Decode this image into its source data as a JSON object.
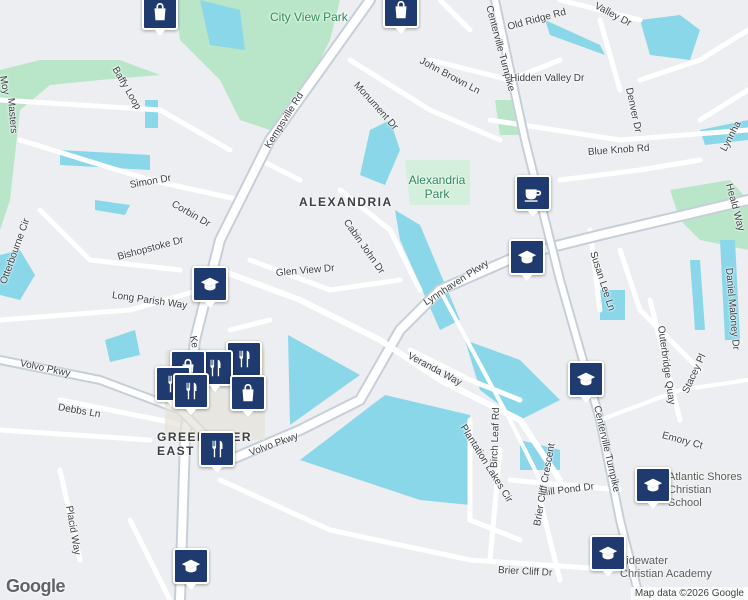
{
  "map": {
    "area_labels": [
      {
        "id": "alexandria",
        "text": "ALEXANDRIA"
      },
      {
        "id": "greenbrier-east",
        "text": "GREENBRIER EAST"
      }
    ],
    "park_labels": [
      {
        "id": "city-view-park",
        "text": "City View Park"
      },
      {
        "id": "alexandria-park",
        "text": "Alexandria Park"
      }
    ],
    "street_labels": [
      {
        "id": "kempsville-rd",
        "text": "Kempsville Rd"
      },
      {
        "id": "kempsville-rd-lower",
        "text": "Ke"
      },
      {
        "id": "monument-dr",
        "text": "Monument Dr"
      },
      {
        "id": "john-brown-ln",
        "text": "John Brown Ln"
      },
      {
        "id": "centerville-tpk-top",
        "text": "Centerville Turnpike"
      },
      {
        "id": "old-ridge-rd",
        "text": "Old Ridge Rd"
      },
      {
        "id": "hidden-valley-dr",
        "text": "Hidden Valley Dr"
      },
      {
        "id": "valley-dr",
        "text": "Valley Dr"
      },
      {
        "id": "denver-dr",
        "text": "Denver Dr"
      },
      {
        "id": "blue-knob-rd",
        "text": "Blue Knob Rd"
      },
      {
        "id": "lynnhaven-top-right",
        "text": "Lynnha"
      },
      {
        "id": "heald-way",
        "text": "Heald Way"
      },
      {
        "id": "baffy-loop",
        "text": "Baffy Loop"
      },
      {
        "id": "masters",
        "text": "Masters"
      },
      {
        "id": "moy",
        "text": "Moy"
      },
      {
        "id": "simon-dr",
        "text": "Simon Dr"
      },
      {
        "id": "corbin-dr",
        "text": "Corbin Dr"
      },
      {
        "id": "cabin-john-dr",
        "text": "Cabin John Dr"
      },
      {
        "id": "glen-view-dr",
        "text": "Glen View Dr"
      },
      {
        "id": "bishopstoke-dr",
        "text": "Bishopstoke Dr"
      },
      {
        "id": "otterbourne-cir",
        "text": "Otterbourne Cir"
      },
      {
        "id": "long-parish-way",
        "text": "Long Parish Way"
      },
      {
        "id": "lynnhaven-pkwy",
        "text": "Lynnhaven Pkwy"
      },
      {
        "id": "susan-lee-ln",
        "text": "Susan Lee Ln"
      },
      {
        "id": "outerbridge-quay",
        "text": "Outerbridge Quay"
      },
      {
        "id": "daniel-maloney-dr",
        "text": "Daniel Maloney Dr"
      },
      {
        "id": "centerville-tpk-right",
        "text": "Centerville Turnpike"
      },
      {
        "id": "stacey-pl",
        "text": "Stacey Pl"
      },
      {
        "id": "emory-ct",
        "text": "Emory Ct"
      },
      {
        "id": "volvo-pkwy-left",
        "text": "Volvo Pkwy"
      },
      {
        "id": "volvo-pkwy-center",
        "text": "Volvo Pkwy"
      },
      {
        "id": "debbs-ln",
        "text": "Debbs Ln"
      },
      {
        "id": "veranda-way",
        "text": "Veranda Way"
      },
      {
        "id": "plantation-lakes-cir",
        "text": "Plantation Lakes Cir"
      },
      {
        "id": "birch-leaf-rd",
        "text": "Birch Leaf Rd"
      },
      {
        "id": "mill-pond-dr",
        "text": "Mill Pond Dr"
      },
      {
        "id": "brier-cliff-crescent",
        "text": "Brier Cliff Crescent"
      },
      {
        "id": "placid-way",
        "text": "Placid Way"
      },
      {
        "id": "brier-cliff-dr",
        "text": "Brier Cliff Dr"
      }
    ],
    "poi_labels": [
      {
        "id": "atlantic-shores-1",
        "text": "Atlantic Shores"
      },
      {
        "id": "atlantic-shores-2",
        "text": "Christian School"
      },
      {
        "id": "tidewater-1",
        "text": "Tidewater"
      },
      {
        "id": "tidewater-2",
        "text": "Christian Academy"
      }
    ],
    "markers": [
      {
        "id": "shopping-top-left",
        "icon": "shopping-bag-icon"
      },
      {
        "id": "shopping-top-center",
        "icon": "shopping-bag-icon"
      },
      {
        "id": "coffee",
        "icon": "coffee-cup-icon"
      },
      {
        "id": "school-lynnhaven",
        "icon": "graduation-cap-icon"
      },
      {
        "id": "school-bishopstoke",
        "icon": "graduation-cap-icon"
      },
      {
        "id": "restaurant-cluster-1",
        "icon": "fork-knife-icon"
      },
      {
        "id": "restaurant-cluster-2",
        "icon": "fork-knife-icon"
      },
      {
        "id": "restaurant-cluster-3",
        "icon": "fork-knife-icon"
      },
      {
        "id": "shopping-cluster-1",
        "icon": "shopping-bag-icon"
      },
      {
        "id": "shopping-cluster-2",
        "icon": "shopping-bag-icon"
      },
      {
        "id": "restaurant-cluster-4",
        "icon": "fork-knife-icon"
      },
      {
        "id": "restaurant-greenbrier",
        "icon": "fork-knife-icon"
      },
      {
        "id": "school-centerville",
        "icon": "graduation-cap-icon"
      },
      {
        "id": "school-atlantic-shores",
        "icon": "graduation-cap-icon"
      },
      {
        "id": "school-tidewater",
        "icon": "graduation-cap-icon"
      },
      {
        "id": "school-bottom",
        "icon": "graduation-cap-icon"
      }
    ],
    "colors": {
      "background": "#eceef1",
      "water": "#8ad7ea",
      "park": "#b9e6c9",
      "road": "#ffffff",
      "highway": "#c6cfd8",
      "marker": "#1e3a6e"
    },
    "logo": "Google",
    "attribution": "Map data ©2026 Google"
  }
}
